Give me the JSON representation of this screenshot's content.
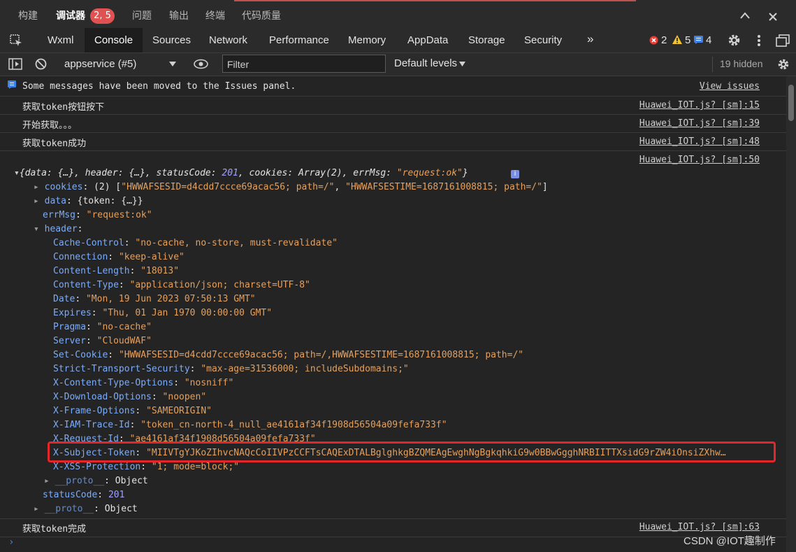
{
  "top_tabs": [
    {
      "label": "构建"
    },
    {
      "label": "调试器"
    },
    {
      "label": "问题"
    },
    {
      "label": "输出"
    },
    {
      "label": "终端"
    },
    {
      "label": "代码质量"
    }
  ],
  "debugger_badge": "2, 5",
  "devtools_tabs": [
    "Wxml",
    "Console",
    "Sources",
    "Network",
    "Performance",
    "Memory",
    "AppData",
    "Storage",
    "Security"
  ],
  "counts": {
    "errors": "2",
    "warnings": "5",
    "info": "4"
  },
  "toolbar": {
    "context": "appservice (#5)",
    "filter_placeholder": "Filter",
    "levels": "Default levels",
    "hidden": "19 hidden"
  },
  "messages": {
    "issues_notice": "Some messages have been moved to the Issues panel.",
    "view_issues": "View issues",
    "log1": "获取token按钮按下",
    "log1_src": "Huawei_IOT.js? [sm]:15",
    "log2": "开始获取。。。",
    "log2_src": "Huawei_IOT.js? [sm]:39",
    "log3": "获取token成功",
    "log3_src": "Huawei_IOT.js? [sm]:48",
    "log4_src": "Huawei_IOT.js? [sm]:50",
    "log5": "获取token完成",
    "log5_src": "Huawei_IOT.js? [sm]:63"
  },
  "object": {
    "summary_prefix": "{data: {…}, header: {…}, statusCode: ",
    "summary_status": "201",
    "summary_mid": ", cookies: Array(2), errMsg: ",
    "summary_errmsg": "\"request:ok\"",
    "summary_end": "}",
    "cookies_key": "cookies",
    "cookies_val": "(2) [",
    "cookie1": "\"HWWAFSESID=d4cdd7ccce69acac56; path=/\"",
    "cookie2": "\"HWWAFSESTIME=1687161008815; path=/\"",
    "data_key": "data",
    "data_val": "{token: {…}}",
    "errmsg_key": "errMsg",
    "errmsg_val": "\"request:ok\"",
    "header_key": "header",
    "headers": [
      {
        "k": "Cache-Control",
        "v": "\"no-cache, no-store, must-revalidate\""
      },
      {
        "k": "Connection",
        "v": "\"keep-alive\""
      },
      {
        "k": "Content-Length",
        "v": "\"18013\""
      },
      {
        "k": "Content-Type",
        "v": "\"application/json; charset=UTF-8\""
      },
      {
        "k": "Date",
        "v": "\"Mon, 19 Jun 2023 07:50:13 GMT\""
      },
      {
        "k": "Expires",
        "v": "\"Thu, 01 Jan 1970 00:00:00 GMT\""
      },
      {
        "k": "Pragma",
        "v": "\"no-cache\""
      },
      {
        "k": "Server",
        "v": "\"CloudWAF\""
      },
      {
        "k": "Set-Cookie",
        "v": "\"HWWAFSESID=d4cdd7ccce69acac56; path=/,HWWAFSESTIME=1687161008815; path=/\""
      },
      {
        "k": "Strict-Transport-Security",
        "v": "\"max-age=31536000; includeSubdomains;\""
      },
      {
        "k": "X-Content-Type-Options",
        "v": "\"nosniff\""
      },
      {
        "k": "X-Download-Options",
        "v": "\"noopen\""
      },
      {
        "k": "X-Frame-Options",
        "v": "\"SAMEORIGIN\""
      },
      {
        "k": "X-IAM-Trace-Id",
        "v": "\"token_cn-north-4_null_ae4161af34f1908d56504a09fefa733f\""
      },
      {
        "k": "X-Request-Id",
        "v": "\"ae4161af34f1908d56504a09fefa733f\""
      },
      {
        "k": "X-Subject-Token",
        "v": "\"MIIVTgYJKoZIhvcNAQcCoIIVPzCCFTsCAQExDTALBglghkgBZQMEAgEwghNgBgkqhkiG9w0BBwGgghNRBIITTXsidG9rZW4iOnsiZXhw…"
      },
      {
        "k": "X-XSS-Protection",
        "v": "\"1; mode=block;\""
      }
    ],
    "proto_key": "__proto__",
    "proto_val": "Object",
    "status_key": "statusCode",
    "status_val": "201"
  },
  "watermark": "CSDN @IOT趣制作",
  "colors": {
    "accent": "#e3262a",
    "key": "#7cacf8",
    "string": "#e5a05e"
  }
}
